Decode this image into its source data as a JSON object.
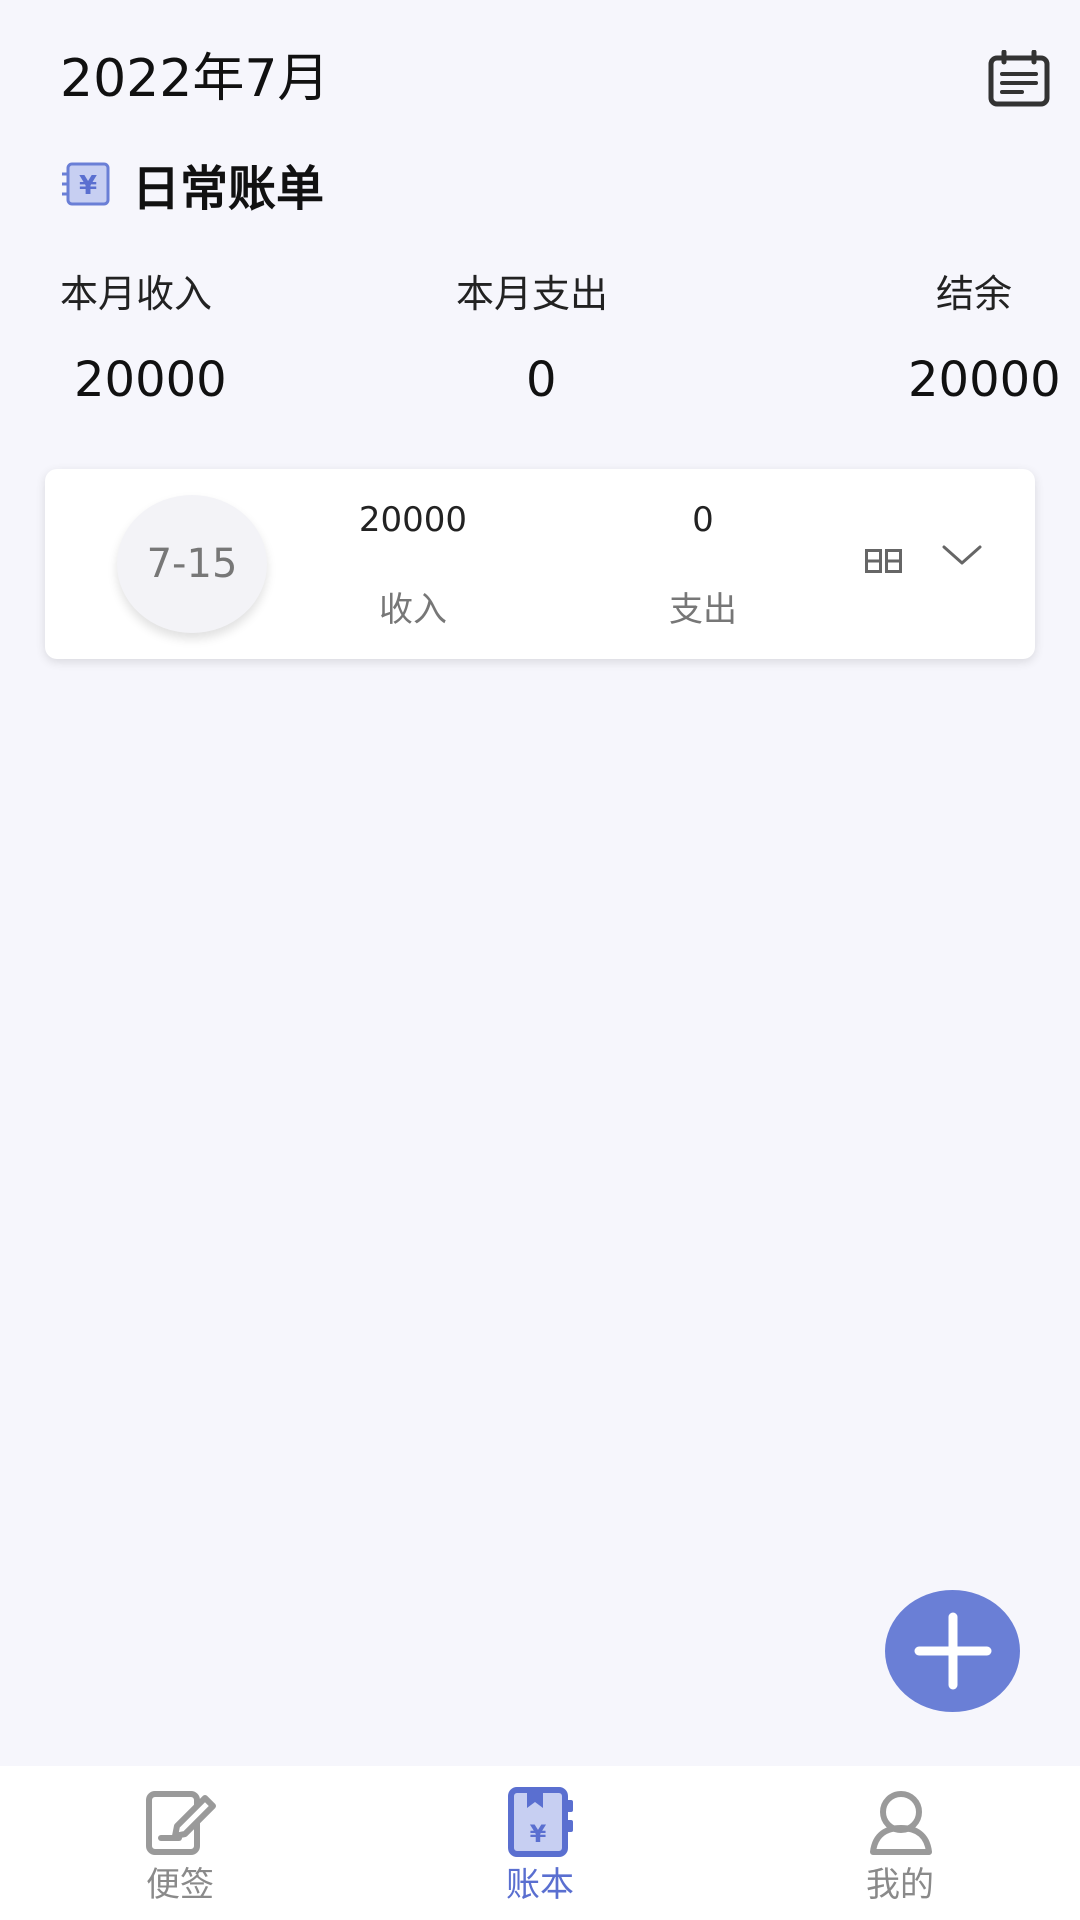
{
  "header": {
    "month_title": "2022年7月"
  },
  "ledger": {
    "name": "日常账单"
  },
  "summary": {
    "income_label": "本月收入",
    "income_value": "20000",
    "expense_label": "本月支出",
    "expense_value": "0",
    "balance_label": "结余",
    "balance_value": "20000"
  },
  "records": [
    {
      "date": "7-15",
      "income_value": "20000",
      "income_label": "收入",
      "expense_value": "0",
      "expense_label": "支出"
    }
  ],
  "tabbar": {
    "tabs": [
      {
        "label": "便签",
        "icon": "note-edit-icon"
      },
      {
        "label": "账本",
        "icon": "ledger-book-icon",
        "active": true
      },
      {
        "label": "我的",
        "icon": "user-icon"
      }
    ]
  },
  "colors": {
    "accent": "#6a7fd6",
    "active_tab": "#5a6fd0",
    "background": "#f6f6fc"
  }
}
